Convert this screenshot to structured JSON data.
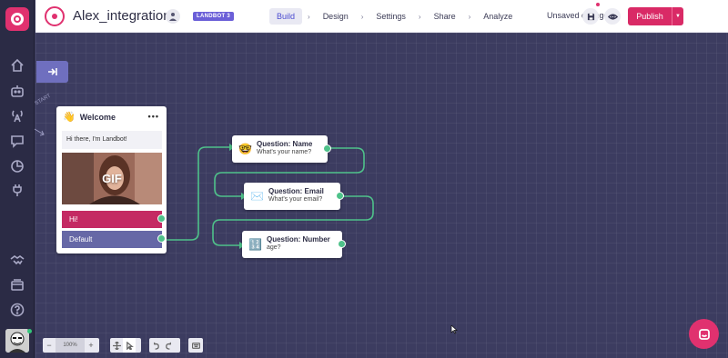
{
  "app": {
    "title": "Alex_integration",
    "badge": "LANDBOT 3",
    "status": "Unsaved changes",
    "publish_label": "Publish"
  },
  "nav": {
    "items": [
      {
        "label": "Build",
        "active": true
      },
      {
        "label": "Design",
        "active": false
      },
      {
        "label": "Settings",
        "active": false
      },
      {
        "label": "Share",
        "active": false
      },
      {
        "label": "Analyze",
        "active": false
      }
    ],
    "separator": "›"
  },
  "sidebar": {
    "icons": [
      "home-icon",
      "bot-icon",
      "broadcast-icon",
      "chat-icon",
      "analytics-icon",
      "integrations-icon",
      "handshake-icon",
      "billing-icon",
      "help-circle-icon"
    ]
  },
  "welcome_node": {
    "emoji": "👋",
    "title": "Welcome",
    "menu": "•••",
    "message": "Hi there, I'm Landbot!",
    "gif_label": "GIF",
    "buttons": [
      "Hi!",
      "Default"
    ]
  },
  "question_nodes": [
    {
      "emoji": "🤓",
      "title": "Question: Name",
      "subtitle": "What's your name?"
    },
    {
      "emoji": "✉️",
      "title": "Question: Email",
      "subtitle": "What's your email?"
    },
    {
      "emoji": "🔢",
      "title": "Question: Number",
      "subtitle": "age?"
    }
  ],
  "toolbar": {
    "zoom_out": "−",
    "zoom_level": "100%",
    "zoom_in": "+"
  },
  "colors": {
    "accent": "#e0316f",
    "connector": "#4fc28a",
    "canvas": "#3c3c60"
  }
}
